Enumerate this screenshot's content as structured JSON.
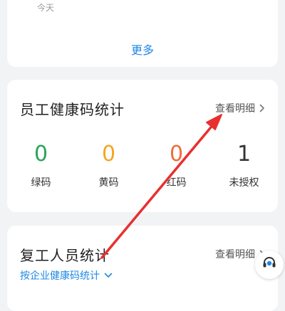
{
  "top_card": {
    "today_label": "今天",
    "more_label": "更多"
  },
  "health_stats": {
    "title": "员工健康码统计",
    "detail_label": "查看明细",
    "items": [
      {
        "value": "0",
        "label": "绿码",
        "color": "#27a55a"
      },
      {
        "value": "0",
        "label": "黄码",
        "color": "#f5a623"
      },
      {
        "value": "0",
        "label": "红码",
        "color": "#f26b3a"
      },
      {
        "value": "1",
        "label": "未授权",
        "color": "#333333"
      }
    ]
  },
  "return_stats": {
    "title": "复工人员统计",
    "detail_label": "查看明细",
    "filter_label": "按企业健康码统计"
  },
  "colors": {
    "accent": "#1e88e5",
    "annotation_arrow": "#e8302f"
  },
  "icons": {
    "detail_chevron": "chevron-right-icon",
    "filter_chevron": "chevron-down-icon",
    "service": "customer-service-icon"
  }
}
